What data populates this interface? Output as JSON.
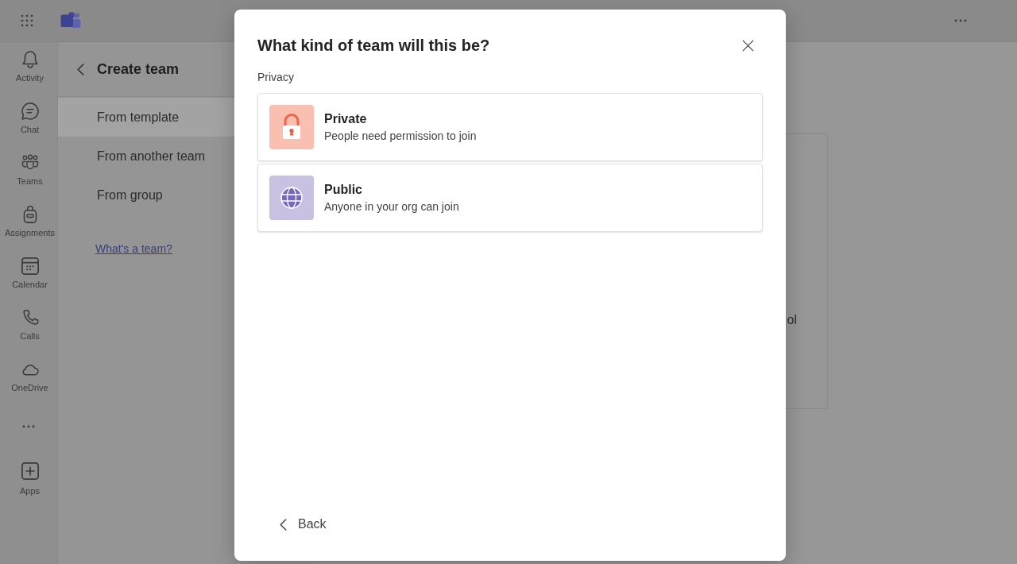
{
  "rail": {
    "items": [
      {
        "label": "Activity",
        "selected": false
      },
      {
        "label": "Chat",
        "selected": false
      },
      {
        "label": "Teams",
        "selected": false
      },
      {
        "label": "Assignments",
        "selected": false
      },
      {
        "label": "Calendar",
        "selected": false
      },
      {
        "label": "Calls",
        "selected": false
      },
      {
        "label": "OneDrive",
        "selected": false
      }
    ],
    "apps": {
      "label": "Apps"
    }
  },
  "panel": {
    "title": "Create team",
    "items": [
      {
        "label": "From template",
        "selected": true
      },
      {
        "label": "From another team",
        "selected": false
      },
      {
        "label": "From group",
        "selected": false
      }
    ],
    "link": "What's a team?"
  },
  "main": {
    "card": {
      "text": "ol"
    }
  },
  "dialog": {
    "title": "What kind of team will this be?",
    "section_label": "Privacy",
    "options": [
      {
        "kind": "private",
        "title": "Private",
        "description": "People need permission to join"
      },
      {
        "kind": "public",
        "title": "Public",
        "description": "Anyone in your org can join"
      }
    ],
    "back_button": "Back"
  }
}
